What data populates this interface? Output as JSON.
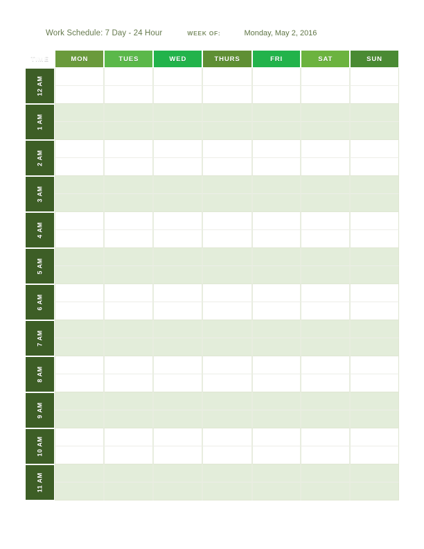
{
  "header": {
    "title": "Work Schedule: 7 Day - 24 Hour",
    "week_of_label": "WEEK OF:",
    "week_of_value": "Monday, May 2, 2016"
  },
  "table": {
    "time_column_header": "TIME",
    "columns": [
      {
        "label": "MON",
        "color": "#6a9a3c"
      },
      {
        "label": "TUES",
        "color": "#5bb84a"
      },
      {
        "label": "WED",
        "color": "#22b34b"
      },
      {
        "label": "THURS",
        "color": "#5f8f34"
      },
      {
        "label": "FRI",
        "color": "#22b34b"
      },
      {
        "label": "SAT",
        "color": "#6cb33f"
      },
      {
        "label": "SUN",
        "color": "#4a8a33"
      }
    ],
    "time_header_color": "#3d5e26",
    "row_band_colors": {
      "white": "#ffffff",
      "green": "#e3edda"
    },
    "rows": [
      {
        "label": "12 AM",
        "band": "white"
      },
      {
        "label": "1 AM",
        "band": "green"
      },
      {
        "label": "2 AM",
        "band": "white"
      },
      {
        "label": "3 AM",
        "band": "green"
      },
      {
        "label": "4 AM",
        "band": "white"
      },
      {
        "label": "5 AM",
        "band": "green"
      },
      {
        "label": "6 AM",
        "band": "white"
      },
      {
        "label": "7 AM",
        "band": "green"
      },
      {
        "label": "8 AM",
        "band": "white"
      },
      {
        "label": "9 AM",
        "band": "green"
      },
      {
        "label": "10 AM",
        "band": "white"
      },
      {
        "label": "11 AM",
        "band": "green"
      }
    ],
    "slots_per_hour": 2
  }
}
